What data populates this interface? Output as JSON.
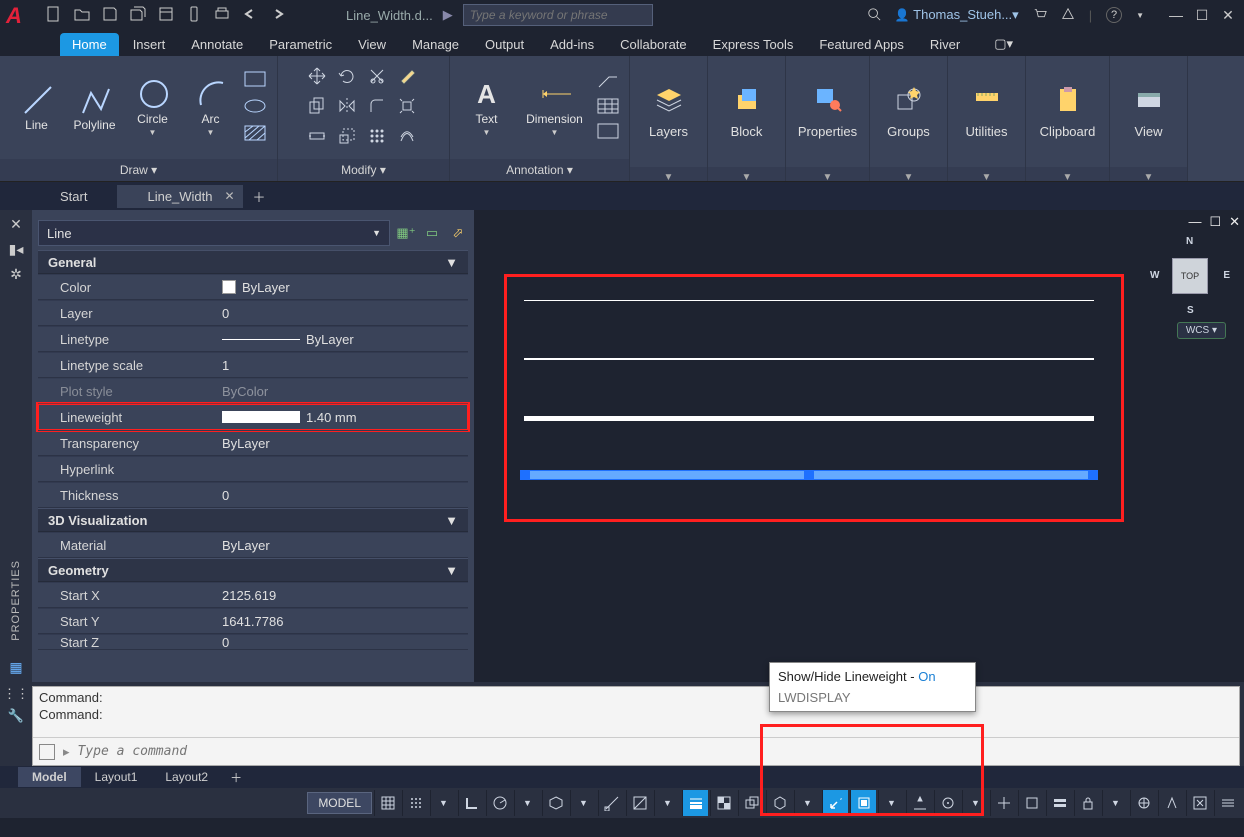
{
  "titlebar": {
    "filename": "Line_Width.d...",
    "search_placeholder": "Type a keyword or phrase",
    "user": "Thomas_Stueh..."
  },
  "menu": {
    "tabs": [
      "Home",
      "Insert",
      "Annotate",
      "Parametric",
      "View",
      "Manage",
      "Output",
      "Add-ins",
      "Collaborate",
      "Express Tools",
      "Featured Apps",
      "River"
    ],
    "active_index": 0
  },
  "ribbon": {
    "draw": {
      "title": "Draw ▾",
      "line": "Line",
      "polyline": "Polyline",
      "circle": "Circle",
      "arc": "Arc"
    },
    "modify": {
      "title": "Modify ▾"
    },
    "annotation": {
      "title": "Annotation ▾",
      "text": "Text",
      "dimension": "Dimension"
    },
    "layers": "Layers",
    "block": "Block",
    "properties": "Properties",
    "groups": "Groups",
    "utilities": "Utilities",
    "clipboard": "Clipboard",
    "view": "View"
  },
  "filetabs": {
    "start": "Start",
    "current": "Line_Width"
  },
  "properties": {
    "selector": "Line",
    "sections": {
      "general": {
        "title": "General",
        "color_k": "Color",
        "color_v": "ByLayer",
        "layer_k": "Layer",
        "layer_v": "0",
        "linetype_k": "Linetype",
        "linetype_v": "ByLayer",
        "ltscale_k": "Linetype scale",
        "ltscale_v": "1",
        "plot_k": "Plot style",
        "plot_v": "ByColor",
        "lw_k": "Lineweight",
        "lw_v": "1.40 mm",
        "trans_k": "Transparency",
        "trans_v": "ByLayer",
        "hyper_k": "Hyperlink",
        "hyper_v": "",
        "thick_k": "Thickness",
        "thick_v": "0"
      },
      "viz": {
        "title": "3D Visualization",
        "material_k": "Material",
        "material_v": "ByLayer"
      },
      "geom": {
        "title": "Geometry",
        "sx_k": "Start X",
        "sx_v": "2125.619",
        "sy_k": "Start Y",
        "sy_v": "1641.7786",
        "sz_k": "Start Z",
        "sz_v": "0"
      }
    },
    "panel_label": "PROPERTIES"
  },
  "viewcube": {
    "top": "TOP",
    "n": "N",
    "s": "S",
    "e": "E",
    "w": "W",
    "wcs": "WCS ▾"
  },
  "command": {
    "hist1": "Command:",
    "hist2": "Command:",
    "placeholder": "Type a command"
  },
  "tooltip": {
    "title": "Show/Hide Lineweight",
    "dash": " - ",
    "state": "On",
    "cmd": "LWDISPLAY"
  },
  "layouts": {
    "model": "Model",
    "l1": "Layout1",
    "l2": "Layout2"
  },
  "status": {
    "model": "MODEL"
  }
}
